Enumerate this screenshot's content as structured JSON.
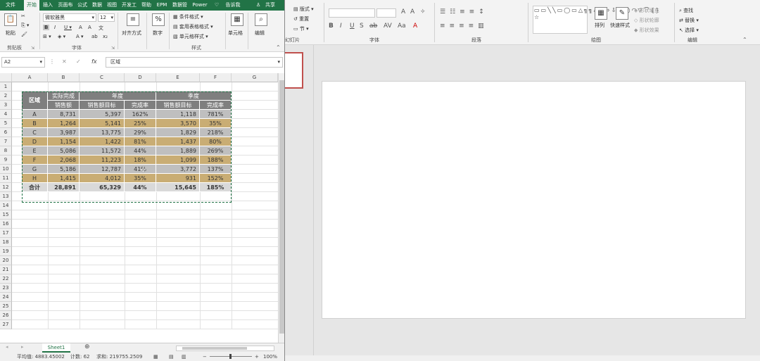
{
  "ppt": {
    "ribbon": {
      "groups": [
        {
          "label": "幻灯片"
        },
        {
          "label": "字体"
        },
        {
          "label": "段落"
        },
        {
          "label": "绘图"
        },
        {
          "label": "编辑"
        }
      ],
      "slide_buttons": [
        "版式",
        "重置",
        "节"
      ],
      "shape_buttons": [
        "排列",
        "快速样式",
        "形状填充",
        "形状轮廓",
        "形状效果"
      ],
      "edit_buttons": [
        "查找",
        "替换",
        "选择"
      ]
    }
  },
  "excel": {
    "tabs": [
      "文件",
      "开始",
      "插入",
      "页面布",
      "公式",
      "数据",
      "视图",
      "开发工",
      "帮助",
      "EPM",
      "数据管",
      "Power",
      "告诉我",
      "共享"
    ],
    "active_tab": "开始",
    "ribbon": {
      "paste_label": "粘贴",
      "font_name": "微软雅黑",
      "font_size": "12",
      "align_label": "对齐方式",
      "number_label": "数字",
      "style_items": [
        "条件格式",
        "套用表格格式",
        "单元格样式"
      ],
      "cell_label": "单元格",
      "edit_label": "编辑",
      "group_labels": [
        "剪贴板",
        "字体",
        "样式"
      ]
    },
    "name_box": "A2",
    "formula_value": "区域",
    "columns": [
      "A",
      "B",
      "C",
      "D",
      "E",
      "F",
      "G"
    ],
    "rows": [
      "1",
      "2",
      "3",
      "4",
      "5",
      "6",
      "7",
      "8",
      "9",
      "10",
      "11",
      "12",
      "13",
      "14",
      "15",
      "16",
      "17",
      "18",
      "19",
      "20",
      "21",
      "22",
      "23",
      "24",
      "25",
      "26",
      "27"
    ],
    "table": {
      "region_header": "区域",
      "actual_header": "实际完成",
      "annual_header": "年度",
      "quarter_header": "季度",
      "sub_headers": [
        "销售额",
        "销售额目标",
        "完成率",
        "销售额目标",
        "完成率"
      ],
      "rows": [
        {
          "region": "A",
          "sales": "8,731",
          "y_target": "5,397",
          "y_rate": "162%",
          "q_target": "1,118",
          "q_rate": "781%"
        },
        {
          "region": "B",
          "sales": "1,264",
          "y_target": "5,141",
          "y_rate": "25%",
          "q_target": "3,570",
          "q_rate": "35%"
        },
        {
          "region": "C",
          "sales": "3,987",
          "y_target": "13,775",
          "y_rate": "29%",
          "q_target": "1,829",
          "q_rate": "218%"
        },
        {
          "region": "D",
          "sales": "1,154",
          "y_target": "1,422",
          "y_rate": "81%",
          "q_target": "1,437",
          "q_rate": "80%"
        },
        {
          "region": "E",
          "sales": "5,086",
          "y_target": "11,572",
          "y_rate": "44%",
          "q_target": "1,889",
          "q_rate": "269%"
        },
        {
          "region": "F",
          "sales": "2,068",
          "y_target": "11,223",
          "y_rate": "18%",
          "q_target": "1,099",
          "q_rate": "188%"
        },
        {
          "region": "G",
          "sales": "5,186",
          "y_target": "12,787",
          "y_rate": "41%",
          "q_target": "3,772",
          "q_rate": "137%"
        },
        {
          "region": "H",
          "sales": "1,415",
          "y_target": "4,012",
          "y_rate": "35%",
          "q_target": "931",
          "q_rate": "152%"
        }
      ],
      "total": {
        "region": "合计",
        "sales": "28,891",
        "y_target": "65,329",
        "y_rate": "44%",
        "q_target": "15,645",
        "q_rate": "185%"
      }
    },
    "sheet_tab": "Sheet1",
    "status": {
      "average": "平均值: 4883.45002",
      "count": "计数: 62",
      "sum": "求和: 219755.2509",
      "zoom": "100%"
    }
  },
  "colors": {
    "excel_green": "#217346",
    "row_gray": "#bfbfbf",
    "row_gold": "#c9ad74",
    "header_gray": "#7f7f7f"
  }
}
